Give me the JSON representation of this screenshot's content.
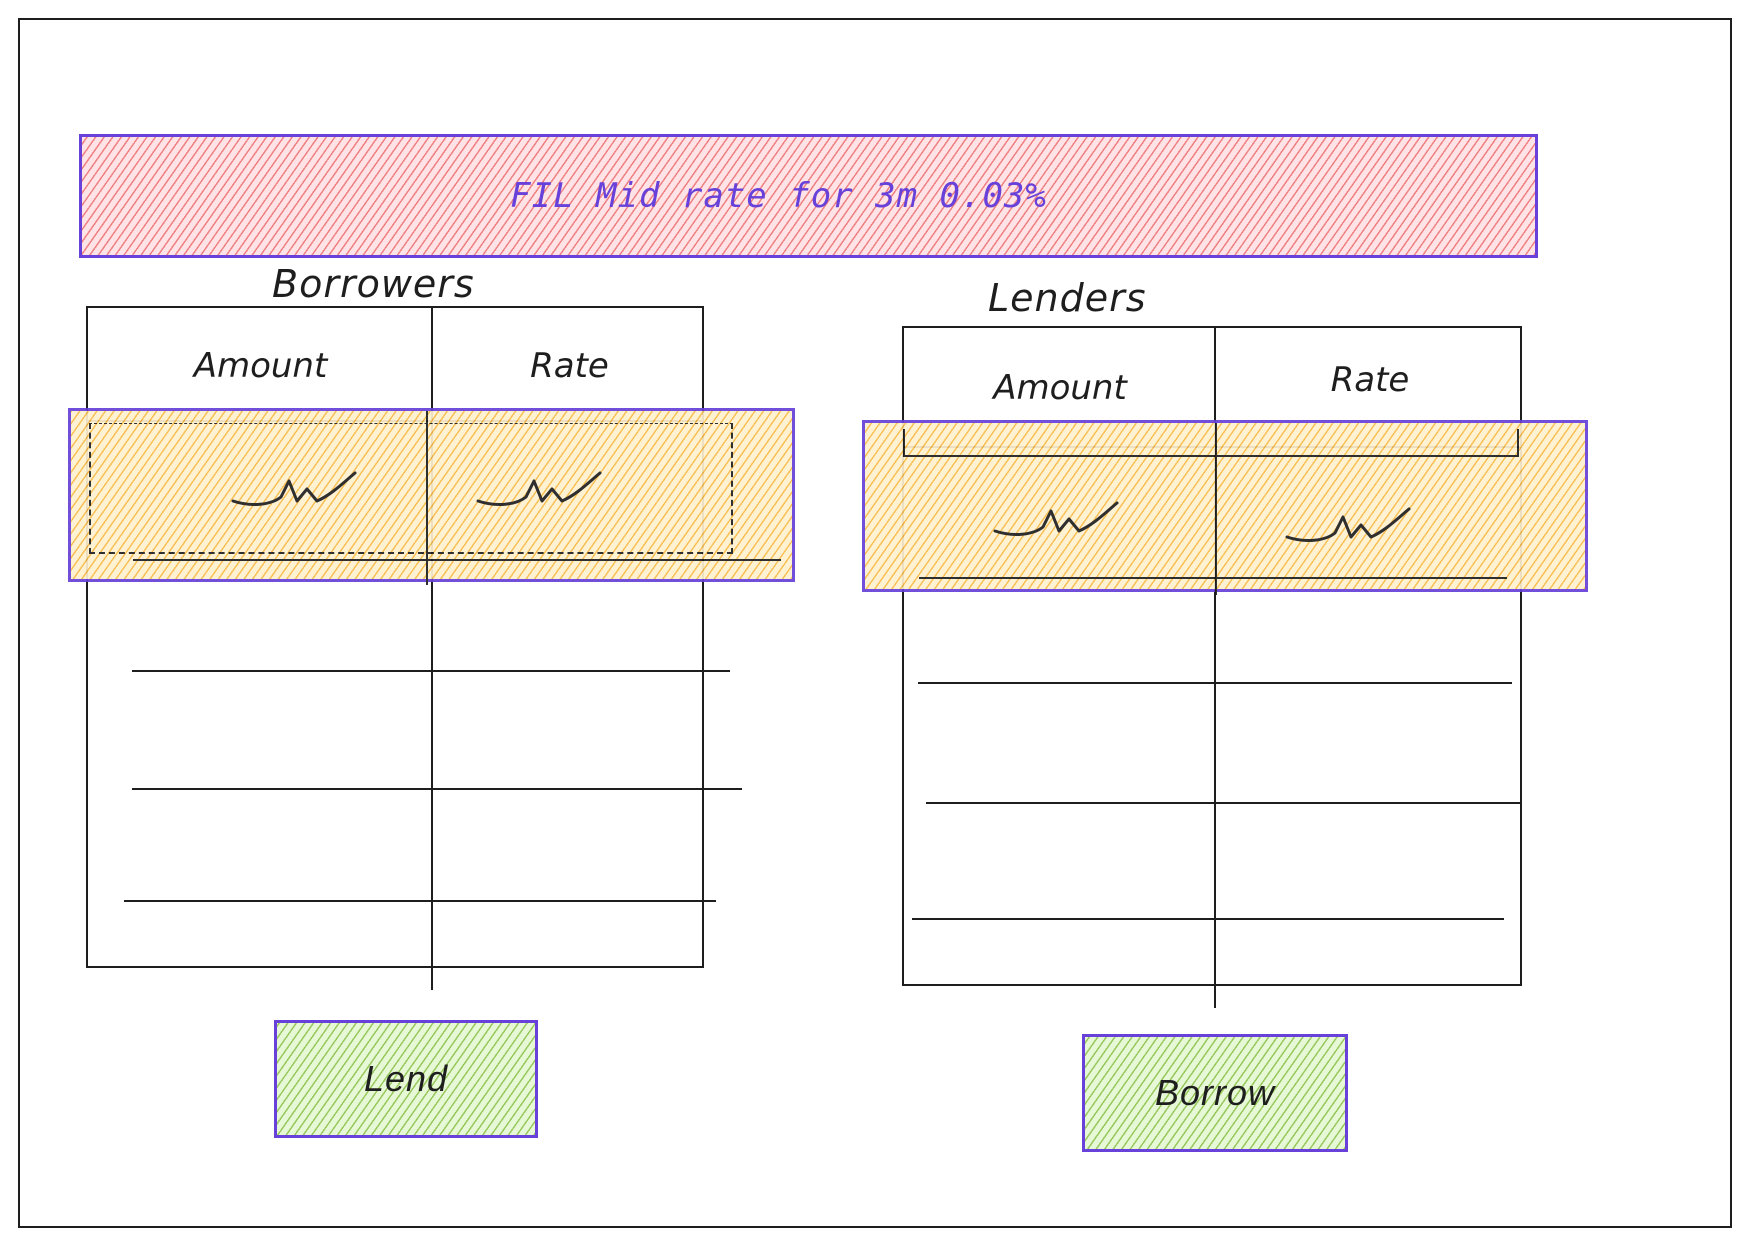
{
  "banner": {
    "text": "FIL Mid rate for 3m 0.03%"
  },
  "borrowers": {
    "title": "Borrowers",
    "columns": [
      "Amount",
      "Rate"
    ]
  },
  "lenders": {
    "title": "Lenders",
    "columns": [
      "Amount",
      "Rate"
    ]
  },
  "buttons": {
    "lend": "Lend",
    "borrow": "Borrow"
  },
  "colors": {
    "accent": "#6741d9",
    "banner_fill": "#e03131",
    "highlight_fill": "#f59f00",
    "button_fill": "#66a80f",
    "ink": "#1e1e1e"
  }
}
